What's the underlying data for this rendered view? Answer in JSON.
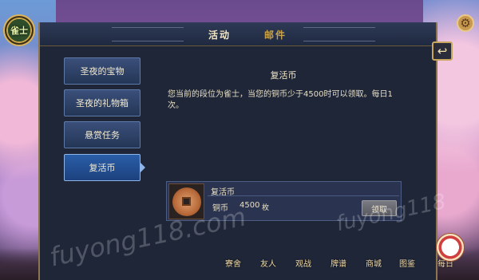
{
  "avatar_badge": "雀士",
  "tabs": [
    {
      "label": "活动",
      "active": true
    },
    {
      "label": "邮件",
      "active": false
    }
  ],
  "sidebar": {
    "items": [
      {
        "label": "圣夜的宝物",
        "active": false
      },
      {
        "label": "圣夜的礼物箱",
        "active": false
      },
      {
        "label": "悬赏任务",
        "active": false
      },
      {
        "label": "复活币",
        "active": true
      }
    ]
  },
  "content": {
    "title": "复活币",
    "description": "您当前的段位为雀士，当您的铜币少于4500时可以领取。每日1次。"
  },
  "reward": {
    "title": "复活币",
    "currency_label": "铜币",
    "amount": "4500",
    "unit": "枚",
    "claim_label": "领取"
  },
  "bottom_nav": [
    "寮舍",
    "友人",
    "观战",
    "牌谱",
    "商城",
    "图鉴",
    "每日"
  ],
  "watermarks": [
    "fuyong118.com",
    "fuyong118"
  ],
  "icons": {
    "settings": "gear-icon",
    "back": "back-arrow-icon",
    "coin": "coin-icon"
  },
  "colors": {
    "panel_bg": "#1e2638",
    "tab_active": "#f4e7c3",
    "tab_inactive": "#c8a24a",
    "sidebar_active": "#2a5ea8"
  }
}
